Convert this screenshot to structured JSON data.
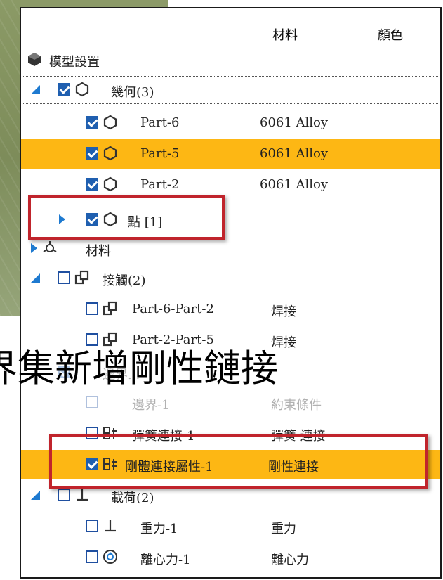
{
  "header": {
    "material_col": "材料",
    "color_col": "顏色"
  },
  "tree": {
    "root": {
      "label": "模型設置"
    },
    "geometry": {
      "label": "幾何(3)"
    },
    "parts": [
      {
        "label": "Part-6",
        "material": "6061 Alloy"
      },
      {
        "label": "Part-5",
        "material": "6061 Alloy"
      },
      {
        "label": "Part-2",
        "material": "6061 Alloy"
      }
    ],
    "point": {
      "label": "點 [1]"
    },
    "materials": {
      "label": "材料"
    },
    "contacts": {
      "label": "接觸(2)"
    },
    "contact_items": [
      {
        "label": "Part-6-Part-2",
        "material": "焊接"
      },
      {
        "label": "Part-2-Part-5",
        "material": "焊接"
      }
    ],
    "connectors": {
      "label": "邊界..."
    },
    "connector_items": [
      {
        "label": "邊界-1",
        "material": "約束條件"
      },
      {
        "label": "彈簧連接-1",
        "material": "彈簧 連接"
      },
      {
        "label": "剛體連接屬性-1",
        "material": "剛性連接"
      }
    ],
    "loads": {
      "label": "載荷(2)"
    },
    "load_items": [
      {
        "label": "重力-1",
        "material": "重力"
      },
      {
        "label": "離心力-1",
        "material": "離心力"
      }
    ]
  },
  "overlay_title": "界集新增剛性鏈接",
  "colors": {
    "highlight": "#fdb714",
    "accent": "#1f5fb0",
    "annotation": "#c0242c"
  }
}
